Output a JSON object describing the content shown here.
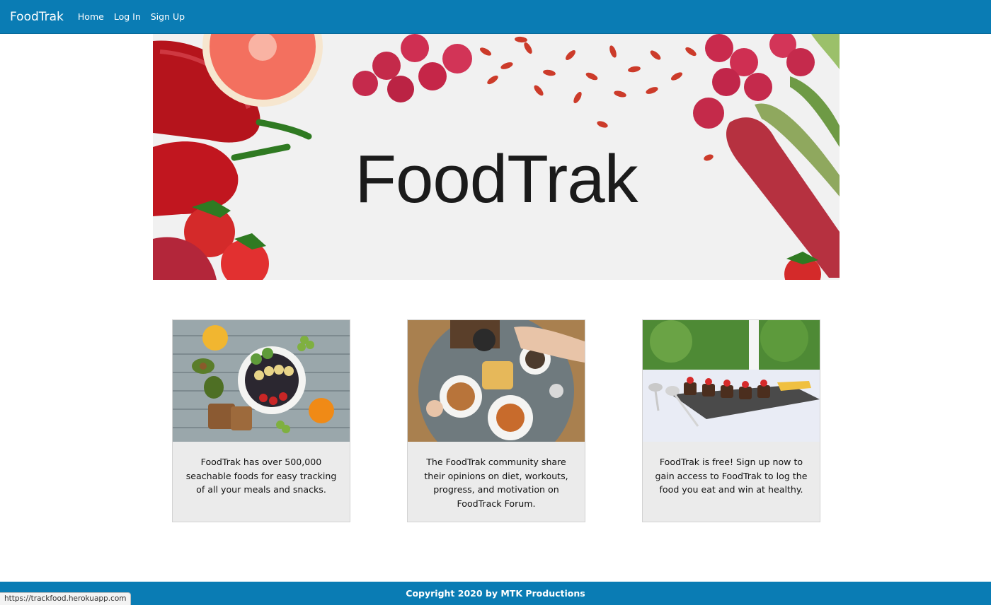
{
  "navbar": {
    "brand": "FoodTrak",
    "links": [
      {
        "label": "Home"
      },
      {
        "label": "Log In"
      },
      {
        "label": "Sign Up"
      }
    ]
  },
  "hero": {
    "title": "FoodTrak"
  },
  "cards": [
    {
      "text": "FoodTrak has over 500,000 seachable foods for easy tracking of all your meals and snacks."
    },
    {
      "text": "The FoodTrak community share their opinions on diet, workouts, progress, and motivation on FoodTrack Forum."
    },
    {
      "text": "FoodTrak is free! Sign up now to gain access to FoodTrak to log the food you eat and win at healthy."
    }
  ],
  "footer": {
    "text": "Copyright 2020 by MTK Productions"
  },
  "status_bar": {
    "url": "https://trackfood.herokuapp.com"
  },
  "colors": {
    "brand_blue": "#0a7cb4",
    "card_background": "#ebebeb"
  }
}
